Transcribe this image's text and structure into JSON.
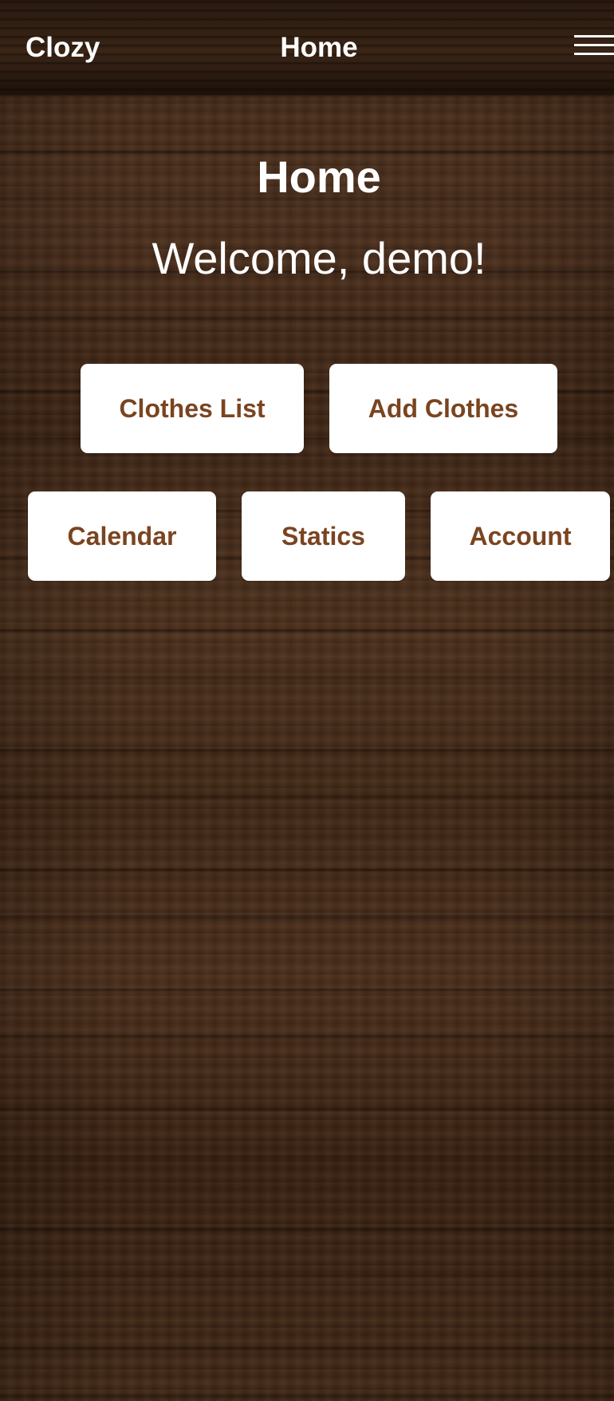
{
  "navbar": {
    "brand": "Clozy",
    "title": "Home",
    "menu_icon": "hamburger-menu-icon"
  },
  "main": {
    "heading": "Home",
    "welcome": "Welcome, demo!",
    "buttons": [
      {
        "label": "Clothes List"
      },
      {
        "label": "Add Clothes"
      },
      {
        "label": "Calendar"
      },
      {
        "label": "Statics"
      },
      {
        "label": "Account"
      }
    ]
  },
  "colors": {
    "button_text": "#7a4420",
    "button_background": "#ffffff",
    "text": "#ffffff"
  }
}
